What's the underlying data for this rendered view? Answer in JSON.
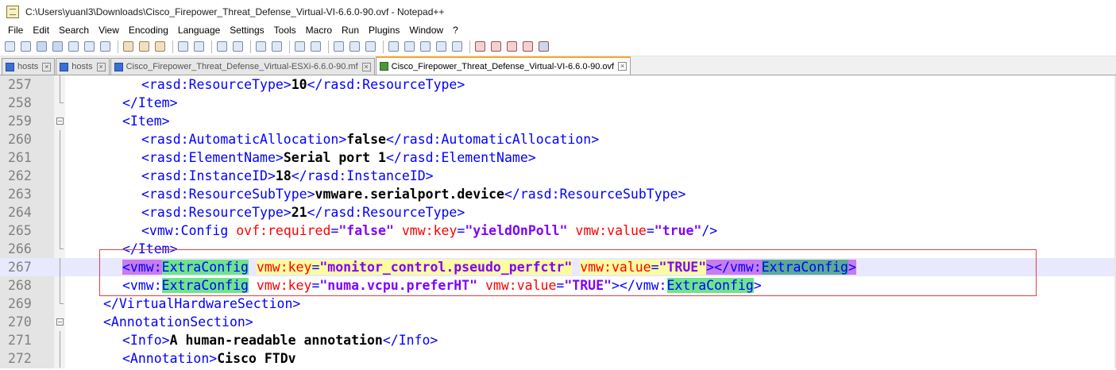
{
  "window": {
    "title": "C:\\Users\\yuanl3\\Downloads\\Cisco_Firepower_Threat_Defense_Virtual-VI-6.6.0-90.ovf - Notepad++"
  },
  "menu": [
    "File",
    "Edit",
    "Search",
    "View",
    "Encoding",
    "Language",
    "Settings",
    "Tools",
    "Macro",
    "Run",
    "Plugins",
    "Window",
    "?"
  ],
  "toolbar": {
    "icons": [
      "new-file-icon",
      "open-file-icon",
      "save-icon",
      "save-all-icon",
      "close-icon",
      "close-all-icon",
      "print-icon",
      "cut-icon",
      "copy-icon",
      "paste-icon",
      "undo-icon",
      "redo-icon",
      "find-icon",
      "replace-icon",
      "zoom-in-icon",
      "zoom-out-icon",
      "sync-vertical-icon",
      "sync-horizontal-icon",
      "word-wrap-icon",
      "show-all-chars-icon",
      "indent-guide-icon",
      "language-icon",
      "doc-map-icon",
      "function-list-icon",
      "folder-icon",
      "monitor-icon",
      "record-macro-icon",
      "stop-macro-icon",
      "play-macro-icon",
      "play-multiple-icon",
      "save-macro-icon"
    ]
  },
  "tabs": [
    {
      "label": "hosts",
      "active": false
    },
    {
      "label": "hosts",
      "active": false
    },
    {
      "label": "Cisco_Firepower_Threat_Defense_Virtual-ESXi-6.6.0-90.mf",
      "active": false
    },
    {
      "label": "Cisco_Firepower_Threat_Defense_Virtual-VI-6.6.0-90.ovf",
      "active": true
    }
  ],
  "lines": [
    {
      "n": "257",
      "fold": "v",
      "indent": 2,
      "parts": [
        [
          "tag",
          "<rasd:ResourceType>"
        ],
        [
          "txt",
          "10"
        ],
        [
          "tag",
          "</rasd:ResourceType>"
        ]
      ]
    },
    {
      "n": "258",
      "fold": "end",
      "indent": 1,
      "parts": [
        [
          "tag",
          "</Item>"
        ]
      ]
    },
    {
      "n": "259",
      "fold": "box",
      "indent": 1,
      "parts": [
        [
          "tag",
          "<Item>"
        ]
      ]
    },
    {
      "n": "260",
      "fold": "v",
      "indent": 2,
      "parts": [
        [
          "tag",
          "<rasd:AutomaticAllocation>"
        ],
        [
          "txt",
          "false"
        ],
        [
          "tag",
          "</rasd:AutomaticAllocation>"
        ]
      ]
    },
    {
      "n": "261",
      "fold": "v",
      "indent": 2,
      "parts": [
        [
          "tag",
          "<rasd:ElementName>"
        ],
        [
          "txt",
          "Serial port 1"
        ],
        [
          "tag",
          "</rasd:ElementName>"
        ]
      ]
    },
    {
      "n": "262",
      "fold": "v",
      "indent": 2,
      "parts": [
        [
          "tag",
          "<rasd:InstanceID>"
        ],
        [
          "txt",
          "18"
        ],
        [
          "tag",
          "</rasd:InstanceID>"
        ]
      ]
    },
    {
      "n": "263",
      "fold": "v",
      "indent": 2,
      "parts": [
        [
          "tag",
          "<rasd:ResourceSubType>"
        ],
        [
          "txt",
          "vmware.serialport.device"
        ],
        [
          "tag",
          "</rasd:ResourceSubType>"
        ]
      ]
    },
    {
      "n": "264",
      "fold": "v",
      "indent": 2,
      "parts": [
        [
          "tag",
          "<rasd:ResourceType>"
        ],
        [
          "txt",
          "21"
        ],
        [
          "tag",
          "</rasd:ResourceType>"
        ]
      ]
    },
    {
      "n": "265",
      "fold": "v",
      "indent": 2,
      "parts": [
        [
          "tag",
          "<vmw:Config "
        ],
        [
          "attr",
          "ovf:required"
        ],
        [
          "tag",
          "="
        ],
        [
          "val",
          "\"false\""
        ],
        [
          "tag",
          " "
        ],
        [
          "attr",
          "vmw:key"
        ],
        [
          "tag",
          "="
        ],
        [
          "val",
          "\"yieldOnPoll\""
        ],
        [
          "tag",
          " "
        ],
        [
          "attr",
          "vmw:value"
        ],
        [
          "tag",
          "="
        ],
        [
          "val",
          "\"true\""
        ],
        [
          "tag",
          "/>"
        ]
      ]
    },
    {
      "n": "266",
      "fold": "end",
      "indent": 1,
      "parts": [
        [
          "tag",
          "</Item>"
        ]
      ]
    },
    {
      "n": "267",
      "fold": "v",
      "indent": 1,
      "hl": true,
      "parts": [
        [
          "tag hl-purple",
          "<vmw:"
        ],
        [
          "tag hl-green",
          "ExtraConfig"
        ],
        [
          "tag",
          " "
        ],
        [
          "attr hl-yellow",
          "vmw:key"
        ],
        [
          "tag hl-yellow",
          "="
        ],
        [
          "val hl-yellow",
          "\"monitor_control.pseudo_perfctr\""
        ],
        [
          "tag",
          " "
        ],
        [
          "attr hl-yellow",
          "vmw:value"
        ],
        [
          "tag hl-yellow",
          "="
        ],
        [
          "val hl-yellow",
          "\"TRUE\""
        ],
        [
          "tag hl-purple",
          "></vmw:"
        ],
        [
          "tag hl-teal",
          "ExtraConfig"
        ],
        [
          "tag hl-purple",
          ">"
        ]
      ]
    },
    {
      "n": "268",
      "fold": "v",
      "indent": 1,
      "parts": [
        [
          "tag",
          "<vmw:"
        ],
        [
          "tag hl-green",
          "ExtraConfig"
        ],
        [
          "tag",
          " "
        ],
        [
          "attr",
          "vmw:key"
        ],
        [
          "tag",
          "="
        ],
        [
          "val",
          "\"numa.vcpu.preferHT\""
        ],
        [
          "tag",
          " "
        ],
        [
          "attr",
          "vmw:value"
        ],
        [
          "tag",
          "="
        ],
        [
          "val",
          "\"TRUE\""
        ],
        [
          "tag",
          "></vmw:"
        ],
        [
          "tag hl-green",
          "ExtraConfig"
        ],
        [
          "tag",
          ">"
        ]
      ]
    },
    {
      "n": "269",
      "fold": "end",
      "indent": 0,
      "parts": [
        [
          "tag",
          "</VirtualHardwareSection>"
        ]
      ]
    },
    {
      "n": "270",
      "fold": "box",
      "indent": 0,
      "parts": [
        [
          "tag",
          "<AnnotationSection>"
        ]
      ]
    },
    {
      "n": "271",
      "fold": "v",
      "indent": 1,
      "parts": [
        [
          "tag",
          "<Info>"
        ],
        [
          "txt",
          "A human-readable annotation"
        ],
        [
          "tag",
          "</Info>"
        ]
      ]
    },
    {
      "n": "272",
      "fold": "v",
      "indent": 1,
      "parts": [
        [
          "tag",
          "<Annotation>"
        ],
        [
          "txt",
          "Cisco FTDv"
        ]
      ]
    }
  ]
}
